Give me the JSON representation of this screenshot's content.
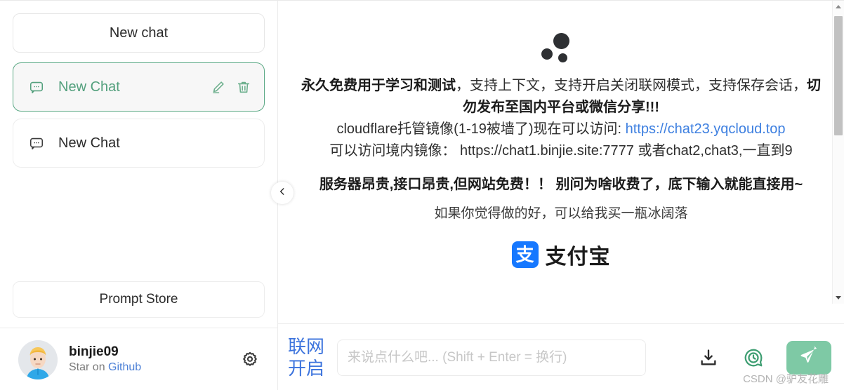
{
  "sidebar": {
    "new_chat_button": "New chat",
    "chats": [
      {
        "label": "New Chat",
        "icon": "chat-bubble-icon",
        "active": true,
        "edit_icon": "pencil-icon",
        "delete_icon": "trash-icon"
      },
      {
        "label": "New Chat",
        "icon": "chat-bubble-icon",
        "active": false
      }
    ],
    "prompt_store_button": "Prompt Store",
    "user": {
      "name": "binjie09",
      "sub_prefix": "Star on ",
      "sub_link": "Github",
      "avatar_icon": "user-avatar",
      "settings_icon": "gear-icon"
    }
  },
  "collapse": {
    "icon": "chevron-left-icon"
  },
  "main": {
    "logo_icon": "brand-dots-logo",
    "welcome": {
      "line1_bold": "永久免费用于学习和测试",
      "line1_rest": "，支持上下文，支持开启关闭联网模式，支持保存会话，",
      "line1_bold2": "切勿发布至国内平台或微信分享!!!",
      "line2_text": "cloudflare托管镜像(1-19被墙了)现在可以访问: ",
      "line2_link": "https://chat23.yqcloud.top",
      "line3": "可以访问境内镜像：  https://chat1.binjie.site:7777 或者chat2,chat3,一直到9",
      "line4_strong": "服务器昂贵,接口昂贵,但网站免费！！ 别问为啥收费了，底下输入就能直接用~",
      "line5": "如果你觉得做的好，可以给我买一瓶冰阔落",
      "alipay_mark": "支",
      "alipay_text": "支付宝"
    }
  },
  "composer": {
    "network_toggle_line1": "联网",
    "network_toggle_line2": "开启",
    "input_value": "",
    "input_placeholder": "来说点什么吧... (Shift + Enter = 换行)",
    "download_icon": "download-icon",
    "history_icon": "clock-chat-icon",
    "send_icon": "send-paper-plane-icon"
  },
  "scrollbar": {
    "up_icon": "scroll-up-arrow-icon",
    "down_icon": "scroll-down-arrow-icon"
  },
  "watermark": "CSDN @驴友花雕",
  "colors": {
    "accent_green": "#53a07d",
    "send_green": "#7ec9a5",
    "link_blue": "#3d7fe0",
    "toggle_blue": "#3d74dd",
    "alipay_blue": "#1678ff"
  }
}
